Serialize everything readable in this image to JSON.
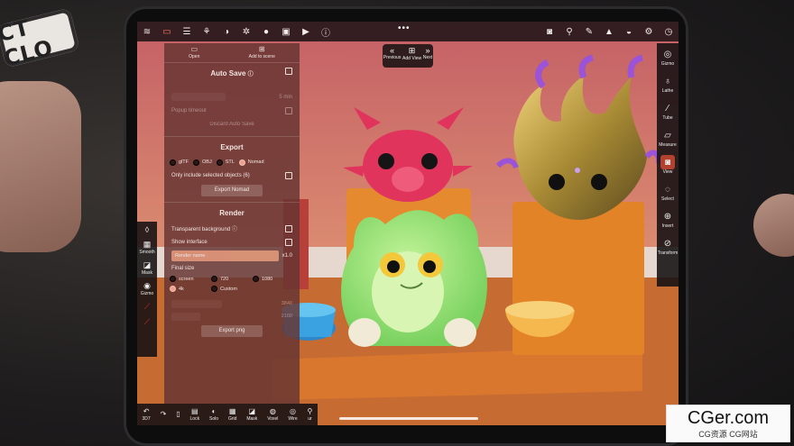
{
  "sticker": "CT CLO",
  "topbar": {
    "icons": [
      "logo-icon",
      "folder-icon",
      "layers-icon",
      "share-nodes-icon",
      "sphere-icon",
      "gear-icon",
      "sun-icon",
      "image-icon",
      "video-icon",
      "info-icon"
    ],
    "right_icons": [
      "camera-icon",
      "filter-icon",
      "brush-icon",
      "triangle-icon",
      "material-icon",
      "settings-icon",
      "clock-icon"
    ],
    "dots": "•••"
  },
  "viewnav": {
    "prev": "Previous",
    "add": "Add View",
    "next": "Next"
  },
  "right_toolbar": [
    {
      "label": "Gizmo",
      "icon": "gizmo-icon"
    },
    {
      "label": "Lathe",
      "icon": "lathe-icon"
    },
    {
      "label": "Tube",
      "icon": "tube-icon"
    },
    {
      "label": "Measure",
      "icon": "ruler-icon"
    },
    {
      "label": "View",
      "icon": "camera-icon",
      "active": true
    },
    {
      "label": "Select",
      "icon": "select-icon"
    },
    {
      "label": "Insert",
      "icon": "insert-icon"
    },
    {
      "label": "Transform",
      "icon": "transform-icon"
    }
  ],
  "panel": {
    "open": "Open",
    "add_to_scene": "Add to scene",
    "autosave": {
      "title": "Auto Save",
      "interval": "5 min",
      "popup": "Popup timeout",
      "discard": "Discard Auto Save"
    },
    "export": {
      "title": "Export",
      "formats": [
        "glTF",
        "OBJ",
        "STL",
        "Nomad"
      ],
      "selected_format": "Nomad",
      "only_selected": "Only include selected objects (6)",
      "button": "Export Nomad"
    },
    "render": {
      "title": "Render",
      "transparent": "Transparent background",
      "show_interface": "Show interface",
      "name_placeholder": "Render name",
      "scale": "x1.0",
      "final_size": "Final size",
      "sizes": [
        "screen",
        "720",
        "1080",
        "4k",
        "Custom"
      ],
      "selected_size": "4k",
      "width": "3840",
      "height": "2160",
      "button": "Export png"
    }
  },
  "left_toolbar": [
    {
      "label": "",
      "icon": "drop-icon"
    },
    {
      "label": "Smooth",
      "icon": "smooth-icon"
    },
    {
      "label": "Mask",
      "icon": "mask-icon"
    },
    {
      "label": "Gizmo",
      "icon": "gizmo-icon"
    }
  ],
  "bottom_toolbar": [
    {
      "label": "3D7",
      "icon": "undo-icon"
    },
    {
      "label": "",
      "icon": "redo-icon"
    },
    {
      "label": "",
      "icon": "trash-icon"
    },
    {
      "label": "Lock",
      "icon": "lock-icon"
    },
    {
      "label": "Solo",
      "icon": "solo-icon"
    },
    {
      "label": "Grid",
      "icon": "grid-icon"
    },
    {
      "label": "Mask",
      "icon": "mask-icon"
    },
    {
      "label": "Voxel",
      "icon": "voxel-icon"
    },
    {
      "label": "Wire",
      "icon": "wire-icon"
    },
    {
      "label": "ur",
      "icon": "more-icon"
    }
  ],
  "watermark": {
    "title": "CGer.com",
    "subtitle": "CG资源 CG网站"
  }
}
